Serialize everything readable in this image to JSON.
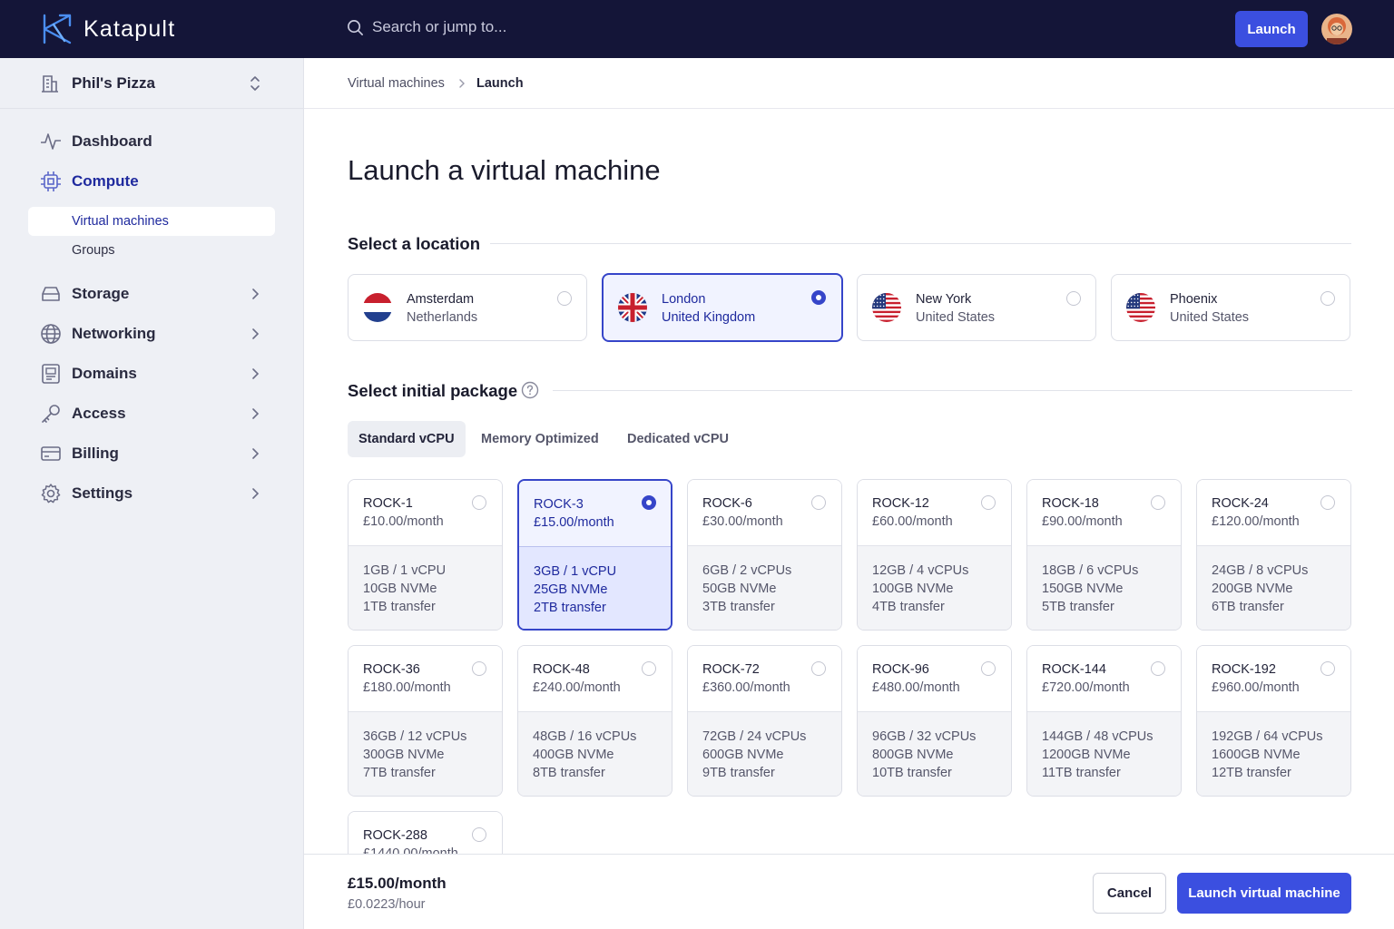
{
  "app": {
    "name": "Katapult"
  },
  "search": {
    "placeholder": "Search or jump to..."
  },
  "topbar": {
    "launch_label": "Launch"
  },
  "sidebar": {
    "org_name": "Phil's Pizza",
    "items": [
      {
        "label": "Dashboard"
      },
      {
        "label": "Compute"
      },
      {
        "label": "Storage"
      },
      {
        "label": "Networking"
      },
      {
        "label": "Domains"
      },
      {
        "label": "Access"
      },
      {
        "label": "Billing"
      },
      {
        "label": "Settings"
      }
    ],
    "compute_sub": [
      {
        "label": "Virtual machines"
      },
      {
        "label": "Groups"
      }
    ]
  },
  "breadcrumb": {
    "parent": "Virtual machines",
    "current": "Launch"
  },
  "page": {
    "title": "Launch a virtual machine",
    "location_heading": "Select a location",
    "package_heading": "Select initial package"
  },
  "locations": [
    {
      "city": "Amsterdam",
      "country": "Netherlands",
      "flag": "netherlands-flag",
      "selected": false
    },
    {
      "city": "London",
      "country": "United Kingdom",
      "flag": "uk-flag",
      "selected": true
    },
    {
      "city": "New York",
      "country": "United States",
      "flag": "us-flag",
      "selected": false
    },
    {
      "city": "Phoenix",
      "country": "United States",
      "flag": "us-flag",
      "selected": false
    }
  ],
  "package_tabs": [
    {
      "label": "Standard vCPU",
      "active": true
    },
    {
      "label": "Memory Optimized",
      "active": false
    },
    {
      "label": "Dedicated vCPU",
      "active": false
    }
  ],
  "packages": [
    {
      "name": "ROCK-1",
      "price": "£10.00/month",
      "specs": [
        "1GB / 1 vCPU",
        "10GB NVMe",
        "1TB transfer"
      ]
    },
    {
      "name": "ROCK-3",
      "price": "£15.00/month",
      "specs": [
        "3GB / 1 vCPU",
        "25GB NVMe",
        "2TB transfer"
      ],
      "selected": true
    },
    {
      "name": "ROCK-6",
      "price": "£30.00/month",
      "specs": [
        "6GB / 2 vCPUs",
        "50GB NVMe",
        "3TB transfer"
      ]
    },
    {
      "name": "ROCK-12",
      "price": "£60.00/month",
      "specs": [
        "12GB / 4 vCPUs",
        "100GB NVMe",
        "4TB transfer"
      ]
    },
    {
      "name": "ROCK-18",
      "price": "£90.00/month",
      "specs": [
        "18GB / 6 vCPUs",
        "150GB NVMe",
        "5TB transfer"
      ]
    },
    {
      "name": "ROCK-24",
      "price": "£120.00/month",
      "specs": [
        "24GB / 8 vCPUs",
        "200GB NVMe",
        "6TB transfer"
      ]
    },
    {
      "name": "ROCK-36",
      "price": "£180.00/month",
      "specs": [
        "36GB / 12 vCPUs",
        "300GB NVMe",
        "7TB transfer"
      ]
    },
    {
      "name": "ROCK-48",
      "price": "£240.00/month",
      "specs": [
        "48GB / 16 vCPUs",
        "400GB NVMe",
        "8TB transfer"
      ]
    },
    {
      "name": "ROCK-72",
      "price": "£360.00/month",
      "specs": [
        "72GB / 24 vCPUs",
        "600GB NVMe",
        "9TB transfer"
      ]
    },
    {
      "name": "ROCK-96",
      "price": "£480.00/month",
      "specs": [
        "96GB / 32 vCPUs",
        "800GB NVMe",
        "10TB transfer"
      ]
    },
    {
      "name": "ROCK-144",
      "price": "£720.00/month",
      "specs": [
        "144GB / 48 vCPUs",
        "1200GB NVMe",
        "11TB transfer"
      ]
    },
    {
      "name": "ROCK-192",
      "price": "£960.00/month",
      "specs": [
        "192GB / 64 vCPUs",
        "1600GB NVMe",
        "12TB transfer"
      ]
    },
    {
      "name": "ROCK-288",
      "price": "£1440.00/month",
      "specs": []
    }
  ],
  "footer": {
    "monthly": "£15.00/month",
    "hourly": "£0.0223/hour",
    "cancel_label": "Cancel",
    "launch_label": "Launch virtual machine"
  },
  "colors": {
    "topbar_bg": "#141538",
    "accent": "#3b4fe0",
    "selected_border": "#3645c9",
    "sidebar_bg": "#eef0f5"
  }
}
